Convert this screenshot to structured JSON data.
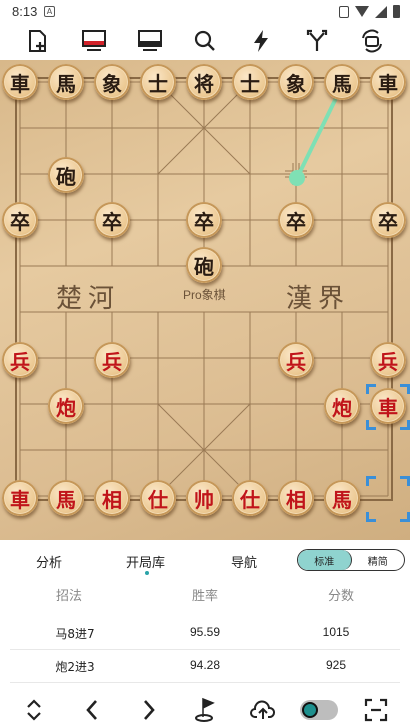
{
  "status_bar": {
    "time": "8:13",
    "notification": "A"
  },
  "toolbar": {
    "icons": [
      "new-file-icon",
      "board-red-icon",
      "board-monitor-icon",
      "search-icon",
      "lightning-icon",
      "branch-icon",
      "rotate-camera-icon"
    ]
  },
  "board": {
    "river_left": "楚河",
    "river_right": "漢界",
    "watermark": "Pro象棋",
    "arrow_color": "#7fe0b4",
    "selection_color": "#3a8fd8",
    "black_row0": [
      "車",
      "馬",
      "象",
      "士",
      "将",
      "士",
      "象",
      "馬",
      "車"
    ],
    "black_cannon_left": "砲",
    "black_cannon_center": "砲",
    "black_pawns": [
      "卒",
      "卒",
      "卒",
      "卒",
      "卒"
    ],
    "red_pawns": [
      "兵",
      "兵",
      "兵",
      "兵"
    ],
    "red_cannon_left": "炮",
    "red_cannon_right": "炮",
    "red_rook_moved": "車",
    "red_row9": [
      "車",
      "馬",
      "相",
      "仕",
      "帅",
      "仕",
      "相",
      "馬"
    ]
  },
  "tabs": {
    "analysis": "分析",
    "opening_book": "开局库",
    "navigation": "导航",
    "mode_standard": "标准",
    "mode_simple": "精简",
    "accent_color": "#8fd3cf"
  },
  "table": {
    "headers": {
      "move": "招法",
      "win_rate": "胜率",
      "score": "分数"
    },
    "rows": [
      {
        "move": "马8进7",
        "win_rate": "95.59",
        "score": "1015"
      },
      {
        "move": "炮2进3",
        "win_rate": "94.28",
        "score": "925"
      }
    ]
  },
  "bottom_bar": {
    "icons": [
      "expand-collapse-icon",
      "previous-icon",
      "next-icon",
      "flag-icon",
      "cloud-upload-icon",
      "toggle-switch",
      "fullscreen-icon"
    ],
    "toggle_color": "#1d8f8d"
  }
}
